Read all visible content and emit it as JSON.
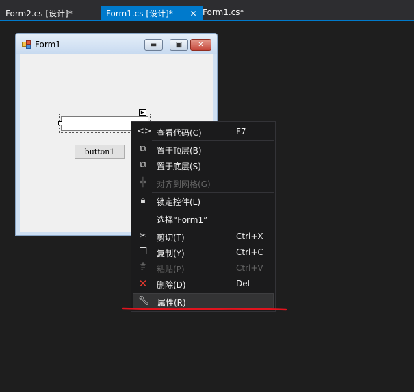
{
  "tabs": [
    {
      "label": "Form2.cs [设计]*"
    },
    {
      "label": "Form1.cs [设计]*",
      "pin_icon": "pin-icon",
      "close_icon": "close-icon"
    },
    {
      "label": "Form1.cs*"
    }
  ],
  "form": {
    "title": "Form1",
    "icon": "form-icon",
    "minimize_icon": "minimize-icon",
    "maximize_icon": "maximize-icon",
    "close_icon": "close-icon",
    "textbox_value": "",
    "button_label": "button1"
  },
  "context_menu": {
    "items": [
      {
        "icon": "code-icon",
        "label": "查看代码(C)",
        "shortcut": "F7",
        "enabled": true
      },
      {
        "icon": "bring-to-front-icon",
        "label": "置于顶层(B)",
        "shortcut": "",
        "enabled": true
      },
      {
        "icon": "send-to-back-icon",
        "label": "置于底层(S)",
        "shortcut": "",
        "enabled": true
      },
      {
        "icon": "align-to-grid-icon",
        "label": "对齐到网格(G)",
        "shortcut": "",
        "enabled": false
      },
      {
        "icon": "lock-icon",
        "label": "锁定控件(L)",
        "shortcut": "",
        "enabled": true
      },
      {
        "icon": "",
        "label": "选择“Form1”",
        "shortcut": "",
        "enabled": true
      },
      {
        "icon": "cut-icon",
        "label": "剪切(T)",
        "shortcut": "Ctrl+X",
        "enabled": true
      },
      {
        "icon": "copy-icon",
        "label": "复制(Y)",
        "shortcut": "Ctrl+C",
        "enabled": true
      },
      {
        "icon": "paste-icon",
        "label": "粘贴(P)",
        "shortcut": "Ctrl+V",
        "enabled": false
      },
      {
        "icon": "delete-icon",
        "label": "删除(D)",
        "shortcut": "Del",
        "enabled": true
      },
      {
        "icon": "wrench-icon",
        "label": "属性(R)",
        "shortcut": "",
        "enabled": true,
        "highlighted": true
      }
    ]
  },
  "colors": {
    "accent": "#007acc",
    "editor_background": "#1e1e1e",
    "annotation": "#e0141e",
    "delete_icon": "#e8392f"
  }
}
